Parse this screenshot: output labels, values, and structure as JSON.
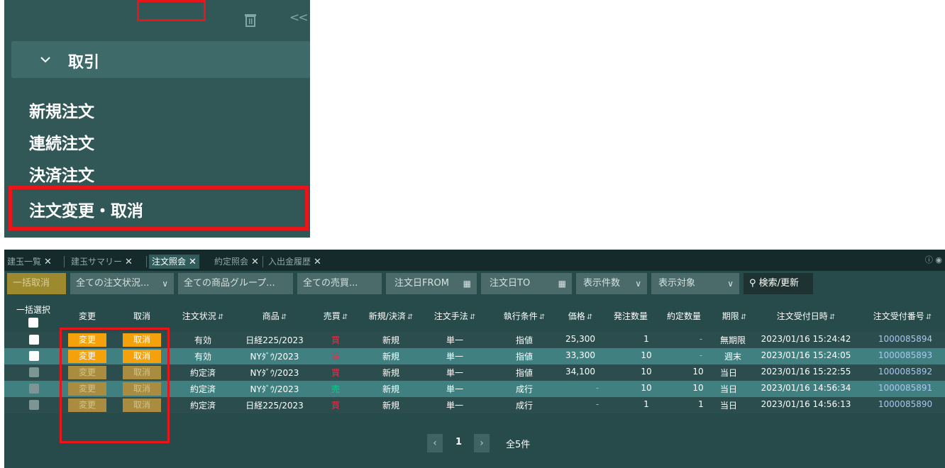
{
  "sidebar": {
    "section_title": "取引",
    "items": [
      "新規注文",
      "連続注文",
      "決済注文",
      "注文変更・取消"
    ]
  },
  "tabs": [
    {
      "label": "建玉一覧"
    },
    {
      "label": "建玉サマリー"
    },
    {
      "label": "注文照会"
    },
    {
      "label": "約定照会"
    },
    {
      "label": "入出金履歴"
    }
  ],
  "tab_close": "✕",
  "toolbar": {
    "bulk_cancel": "一括取消",
    "status_filter": "全ての注文状況...",
    "product_filter": "全ての商品グループ...",
    "side_filter": "全ての売買...",
    "date_from": "注文日FROM",
    "date_to": "注文日TO",
    "display_count": "表示件数",
    "display_target": "表示対象",
    "search": "検索/更新"
  },
  "table": {
    "headers": {
      "bulk_select": "一括選択",
      "change": "変更",
      "cancel": "取消",
      "status": "注文状況",
      "product": "商品",
      "side": "売買",
      "new_close": "新規/決済",
      "method": "注文手法",
      "condition": "執行条件",
      "price": "価格",
      "order_qty": "発注数量",
      "exec_qty": "約定数量",
      "expiry": "期限",
      "received_at": "注文受付日時",
      "order_no": "注文受付番号"
    },
    "change_label": "変更",
    "cancel_label": "取消",
    "rows": [
      {
        "status": "有効",
        "product": "日経225/2023",
        "side": "買",
        "new_close": "新規",
        "method": "単一",
        "condition": "指値",
        "price": "25,300",
        "order_qty": "1",
        "exec_qty": "-",
        "expiry": "無期限",
        "received_at": "2023/01/16 15:24:42",
        "order_no": "1000085894"
      },
      {
        "status": "有効",
        "product": "NYﾀﾞｳ/2023",
        "side": "買",
        "new_close": "新規",
        "method": "単一",
        "condition": "指値",
        "price": "33,300",
        "order_qty": "10",
        "exec_qty": "-",
        "expiry": "週末",
        "received_at": "2023/01/16 15:24:05",
        "order_no": "1000085893"
      },
      {
        "status": "約定済",
        "product": "NYﾀﾞｳ/2023",
        "side": "買",
        "new_close": "新規",
        "method": "単一",
        "condition": "指値",
        "price": "34,100",
        "order_qty": "10",
        "exec_qty": "10",
        "expiry": "当日",
        "received_at": "2023/01/16 15:22:55",
        "order_no": "1000085892"
      },
      {
        "status": "約定済",
        "product": "NYﾀﾞｳ/2023",
        "side": "売",
        "new_close": "新規",
        "method": "単一",
        "condition": "成行",
        "price": "-",
        "order_qty": "10",
        "exec_qty": "10",
        "expiry": "当日",
        "received_at": "2023/01/16 14:56:34",
        "order_no": "1000085891"
      },
      {
        "status": "約定済",
        "product": "日経225/2023",
        "side": "買",
        "new_close": "新規",
        "method": "単一",
        "condition": "成行",
        "price": "-",
        "order_qty": "1",
        "exec_qty": "1",
        "expiry": "当日",
        "received_at": "2023/01/16 14:56:13",
        "order_no": "1000085890"
      }
    ]
  },
  "pager": {
    "current": "1",
    "total": "全5件"
  },
  "colors": {
    "sidebar_bg": "#325757",
    "panel_bg": "#274a4a",
    "buy": "#e2314a",
    "sell": "#18c38f",
    "action_enabled": "#f4a10c",
    "highlight": "#e8161b"
  }
}
